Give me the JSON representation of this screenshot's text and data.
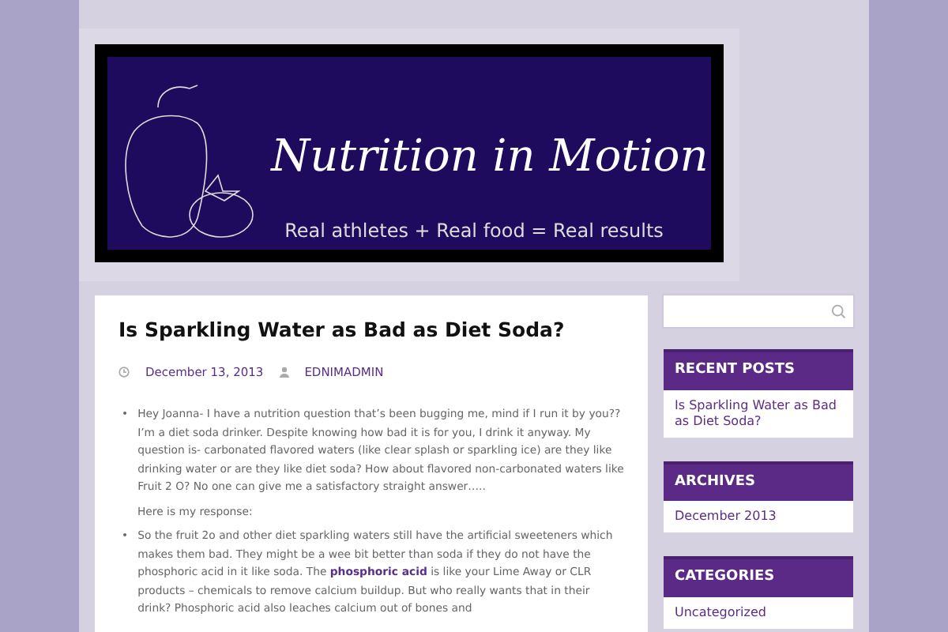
{
  "banner": {
    "title": "Nutrition in Motion",
    "tagline": "Real athletes + Real food = Real results"
  },
  "post": {
    "title": "Is Sparkling Water as Bad as Diet Soda?",
    "date": "December 13, 2013",
    "author": "EDNIMADMIN",
    "blocks": [
      {
        "kind": "bullet",
        "marker": "•",
        "text": "Hey Joanna- I have a nutrition question that’s been bugging me, mind if I run it by you?? I’m a diet soda drinker. Despite knowing how bad it is for you, I drink it anyway. My question is- carbonated flavored waters (like clear splash or sparkling ice) are they like drinking water or are they like diet soda? How about flavored non-carbonated waters like Fruit 2 O? No one can give me a satisfactory straight answer….."
      },
      {
        "kind": "para",
        "text": "Here is my response:"
      },
      {
        "kind": "bullet",
        "marker": "•",
        "before": "So the fruit 2o and other diet sparkling waters still have the artificial sweeteners which makes them bad. They might be a wee bit better than soda if they do not have the phosphoric acid in it like soda. The ",
        "link": "phosphoric acid",
        "after": " is like your Lime Away or CLR products – chemicals to remove calcium buildup. But who really wants that in their drink?  Phosphoric acid also leaches calcium out of bones and"
      }
    ]
  },
  "sidebar": {
    "widgets": [
      {
        "title": "RECENT POSTS",
        "items": [
          "Is Sparkling Water as Bad as Diet Soda?"
        ]
      },
      {
        "title": "ARCHIVES",
        "items": [
          "December 2013"
        ]
      },
      {
        "title": "CATEGORIES",
        "items": [
          "Uncategorized"
        ]
      }
    ]
  }
}
